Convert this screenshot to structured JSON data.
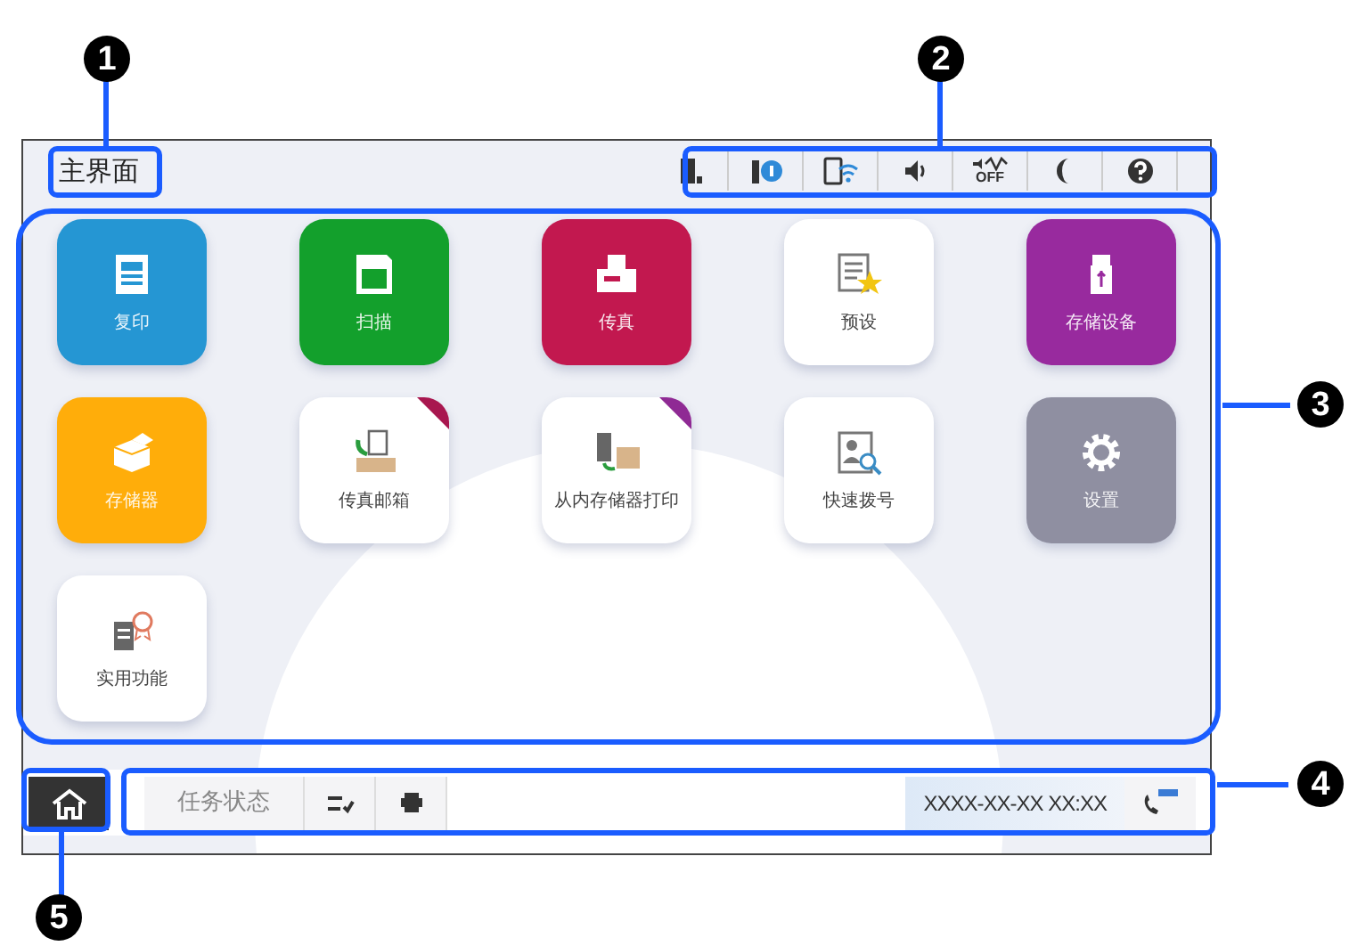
{
  "screen": {
    "title": "主界面",
    "status_icons": {
      "sound_off_label": "OFF"
    },
    "tiles": [
      {
        "label": "复印",
        "kind": "filled",
        "color": "#2596d3",
        "flag": false
      },
      {
        "label": "扫描",
        "kind": "filled",
        "color": "#13a02c",
        "flag": false
      },
      {
        "label": "传真",
        "kind": "filled",
        "color": "#c2184f",
        "flag": false
      },
      {
        "label": "预设",
        "kind": "plain",
        "color": "#ffffff",
        "flag": false
      },
      {
        "label": "存储设备",
        "kind": "filled",
        "color": "#982a9e",
        "flag": false
      },
      {
        "label": "存储器",
        "kind": "filled",
        "color": "#ffad0a",
        "flag": false
      },
      {
        "label": "传真邮箱",
        "kind": "plain",
        "color": "#ffffff",
        "flag": true
      },
      {
        "label": "从内存储器打印",
        "kind": "plain",
        "color": "#ffffff",
        "flag": true
      },
      {
        "label": "快速拨号",
        "kind": "plain",
        "color": "#ffffff",
        "flag": false
      },
      {
        "label": "设置",
        "kind": "filled",
        "color": "#8f8fa1",
        "flag": false
      },
      {
        "label": "实用功能",
        "kind": "plain",
        "color": "#ffffff",
        "flag": false
      }
    ],
    "bottom_bar": {
      "job_status": "任务状态",
      "datetime": "XXXX-XX-XX XX:XX"
    }
  },
  "callouts": [
    "1",
    "2",
    "3",
    "4",
    "5"
  ]
}
